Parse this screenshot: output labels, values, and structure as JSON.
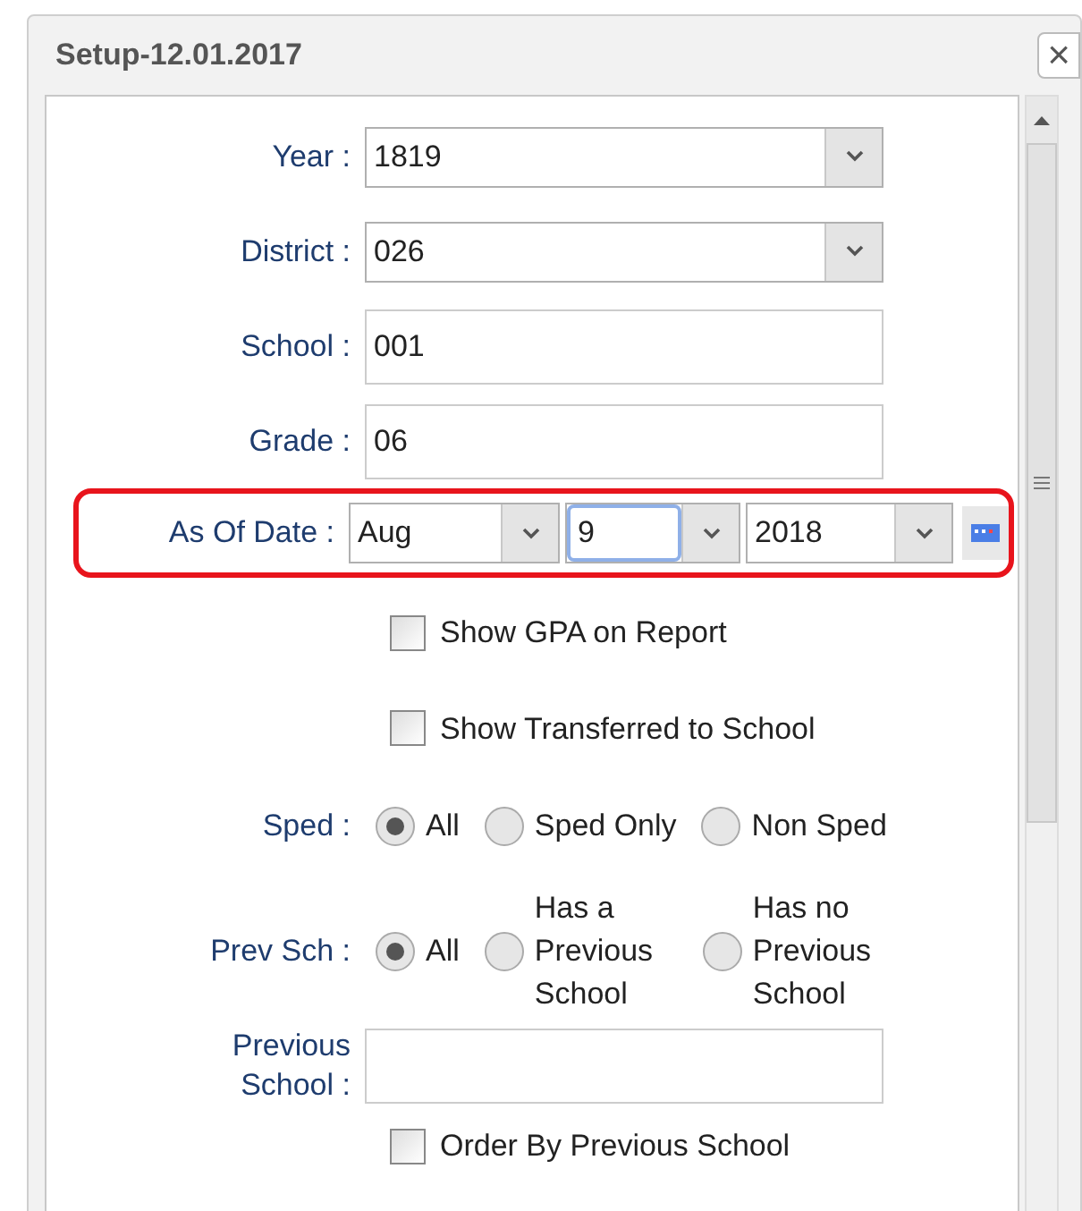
{
  "window": {
    "title": "Setup-12.01.2017",
    "close": "×"
  },
  "fields": [
    {
      "kind": "select",
      "label": "Year :",
      "value": "1819"
    },
    {
      "kind": "select",
      "label": "District :",
      "value": "026"
    },
    {
      "kind": "text",
      "label": "School :",
      "value": "001"
    },
    {
      "kind": "text",
      "label": "Grade :",
      "value": "06"
    }
  ],
  "as_of_date": {
    "label": "As Of Date :",
    "month": "Aug",
    "day": "9",
    "year": "2018",
    "highlighted": true
  },
  "checkboxes_top": [
    {
      "label": "Show GPA on Report",
      "checked": false
    },
    {
      "label": "Show Transferred to School",
      "checked": false
    }
  ],
  "radio_groups": [
    {
      "label": "Sped :",
      "options": [
        {
          "label": "All",
          "selected": true
        },
        {
          "label": "Sped Only",
          "selected": false
        },
        {
          "label": "Non Sped",
          "selected": false
        }
      ]
    },
    {
      "label": "Prev Sch :",
      "options": [
        {
          "label": "All",
          "selected": true
        },
        {
          "label": "Has a Previous School",
          "selected": false
        },
        {
          "label": "Has no Previous School",
          "selected": false
        }
      ]
    }
  ],
  "previous_school": {
    "label": "Previous School :"
  },
  "checkboxes_bottom": [
    {
      "label": "Order By Previous School",
      "checked": false
    }
  ]
}
